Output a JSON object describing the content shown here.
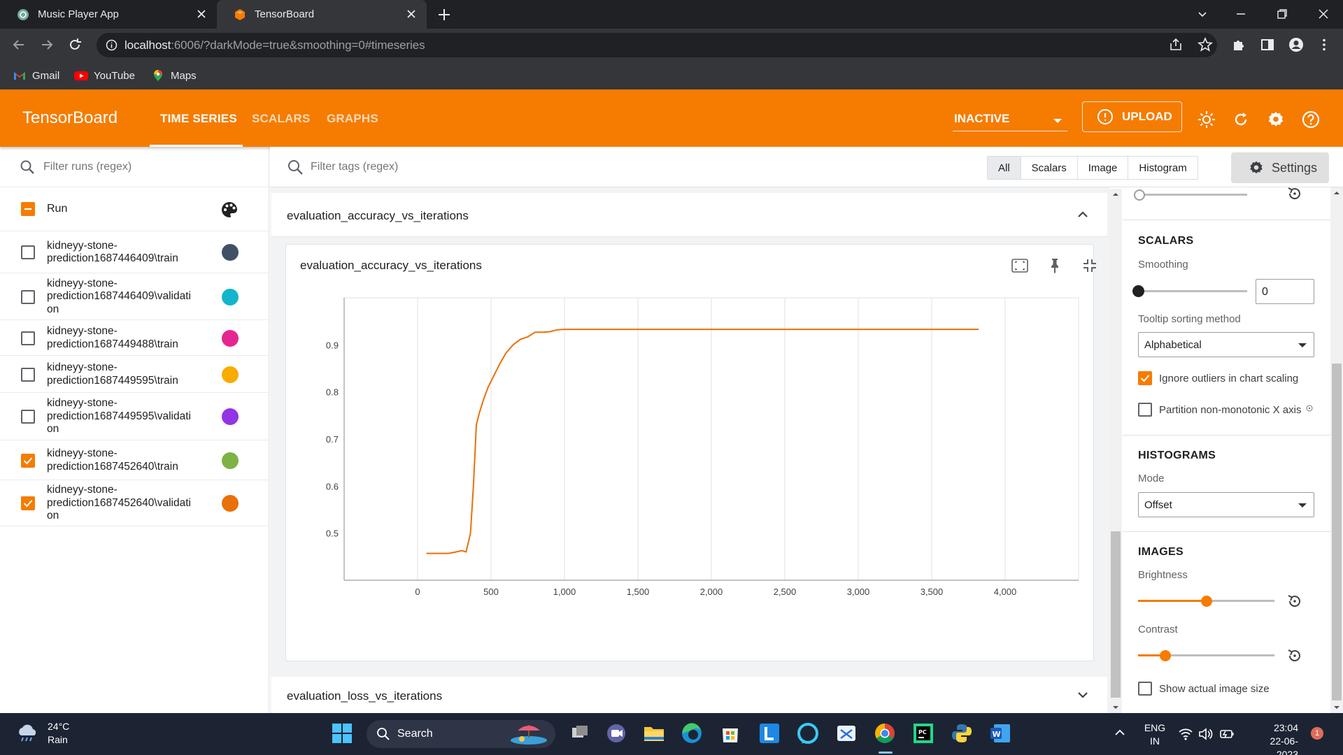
{
  "browser": {
    "tabs": [
      {
        "title": "Music Player App",
        "active": false
      },
      {
        "title": "TensorBoard",
        "active": true
      }
    ],
    "url_host": "localhost",
    "url_rest": ":6006/?darkMode=true&smoothing=0#timeseries",
    "bookmarks": [
      {
        "label": "Gmail",
        "icon": "gmail-icon"
      },
      {
        "label": "YouTube",
        "icon": "youtube-icon"
      },
      {
        "label": "Maps",
        "icon": "maps-icon"
      }
    ]
  },
  "header": {
    "brand": "TensorBoard",
    "tabs": [
      "TIME SERIES",
      "SCALARS",
      "GRAPHS"
    ],
    "active_tab": "TIME SERIES",
    "run_state": "INACTIVE",
    "upload_label": "UPLOAD",
    "accent": "#f57c00"
  },
  "runs": {
    "filter_placeholder": "Filter runs (regex)",
    "header_label": "Run",
    "items": [
      {
        "line1": "kidneyy-stone-",
        "line2": "prediction1687446409\\train",
        "line3": "",
        "checked": false,
        "color": "#425066"
      },
      {
        "line1": "kidneyy-stone-",
        "line2": "prediction1687446409\\validati",
        "line3": "on",
        "checked": false,
        "color": "#12b5cb"
      },
      {
        "line1": "kidneyy-stone-",
        "line2": "prediction1687449488\\train",
        "line3": "",
        "checked": false,
        "color": "#e52592"
      },
      {
        "line1": "kidneyy-stone-",
        "line2": "prediction1687449595\\train",
        "line3": "",
        "checked": false,
        "color": "#f9ab00"
      },
      {
        "line1": "kidneyy-stone-",
        "line2": "prediction1687449595\\validati",
        "line3": "on",
        "checked": false,
        "color": "#9334e6"
      },
      {
        "line1": "kidneyy-stone-",
        "line2": "prediction1687452640\\train",
        "line3": "",
        "checked": true,
        "color": "#7cb342"
      },
      {
        "line1": "kidneyy-stone-",
        "line2": "prediction1687452640\\validati",
        "line3": "on",
        "checked": true,
        "color": "#e8710a"
      }
    ]
  },
  "main": {
    "tag_filter_placeholder": "Filter tags (regex)",
    "type_filters": [
      "All",
      "Scalars",
      "Image",
      "Histogram"
    ],
    "active_type": "All",
    "settings_label": "Settings",
    "group1_title": "evaluation_accuracy_vs_iterations",
    "card_title": "evaluation_accuracy_vs_iterations",
    "group2_title": "evaluation_loss_vs_iterations"
  },
  "settings": {
    "scalars_title": "SCALARS",
    "smoothing_label": "Smoothing",
    "smoothing_value": "0",
    "smoothing_level": 0,
    "tooltip_label": "Tooltip sorting method",
    "tooltip_value": "Alphabetical",
    "ignore_outliers_label": "Ignore outliers in chart scaling",
    "ignore_outliers": true,
    "partition_label": "Partition non-monotonic X axis",
    "partition": false,
    "histograms_title": "HISTOGRAMS",
    "mode_label": "Mode",
    "mode_value": "Offset",
    "images_title": "IMAGES",
    "brightness_label": "Brightness",
    "brightness_level": 0.5,
    "contrast_label": "Contrast",
    "contrast_level": 0.2,
    "actual_size_label": "Show actual image size",
    "actual_size": false
  },
  "chart_data": {
    "type": "line",
    "title": "evaluation_accuracy_vs_iterations",
    "xlabel": "",
    "ylabel": "",
    "xlim": [
      -500,
      4500
    ],
    "ylim": [
      0.4,
      1.0
    ],
    "x_ticks": [
      0,
      500,
      1000,
      1500,
      2000,
      2500,
      3000,
      3500,
      4000
    ],
    "x_tick_labels": [
      "0",
      "500",
      "1,000",
      "1,500",
      "2,000",
      "2,500",
      "3,000",
      "3,500",
      "4,000"
    ],
    "y_ticks": [
      0.5,
      0.6,
      0.7,
      0.8,
      0.9
    ],
    "y_tick_labels": [
      "0.5",
      "0.6",
      "0.7",
      "0.8",
      "0.9"
    ],
    "grid": true,
    "series": [
      {
        "color": "#e8710a",
        "x": [
          60,
          140,
          210,
          260,
          300,
          330,
          360,
          380,
          400,
          420,
          450,
          480,
          520,
          560,
          600,
          650,
          700,
          750,
          800,
          850,
          900,
          950,
          1000,
          1500,
          2000,
          2500,
          3000,
          3500,
          3820
        ],
        "y": [
          0.457,
          0.457,
          0.457,
          0.46,
          0.463,
          0.46,
          0.5,
          0.6,
          0.73,
          0.755,
          0.785,
          0.81,
          0.835,
          0.86,
          0.882,
          0.9,
          0.912,
          0.917,
          0.927,
          0.927,
          0.928,
          0.932,
          0.933,
          0.933,
          0.933,
          0.933,
          0.933,
          0.933,
          0.933
        ]
      }
    ]
  },
  "taskbar": {
    "temperature": "24°C",
    "weather": "Rain",
    "search_label": "Search",
    "lang1": "ENG",
    "lang2": "IN",
    "time": "23:04",
    "date": "22-06-2023",
    "notifications": "1"
  }
}
